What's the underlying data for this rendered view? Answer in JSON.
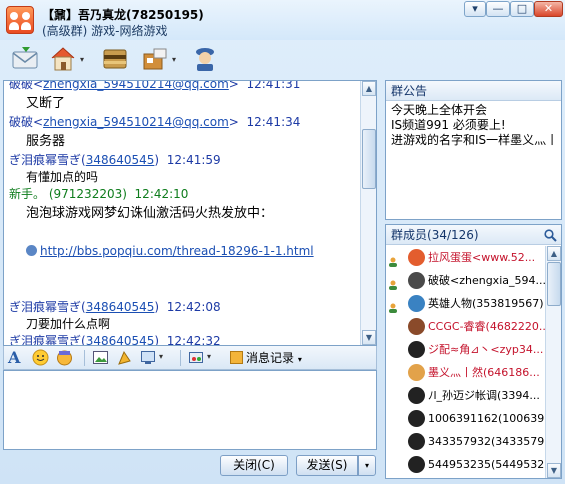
{
  "window": {
    "title": "【鼐】吾乃真龙(78250195)",
    "subtitle": "(高级群) 游戏-网络游戏",
    "buttons": {
      "menu": "▾",
      "minimize": "—",
      "maximize": "□",
      "close": "✕"
    }
  },
  "toolbar": {
    "items": [
      {
        "icon": "email-icon"
      },
      {
        "icon": "home-icon"
      },
      {
        "icon": "share-icon"
      },
      {
        "icon": "apps-icon"
      },
      {
        "icon": "manage-icon"
      }
    ]
  },
  "chat": {
    "messages": [
      {
        "sender": "破破",
        "email": "zhengxia_594510214@qq.com",
        "time": "12:41:31",
        "text": "又断了"
      },
      {
        "sender": "破破",
        "email": "zhengxia_594510214@qq.com",
        "time": "12:41:34",
        "text": "服务器"
      },
      {
        "sender": "ぎ泪痕幂雪ぎ",
        "qq": "348640545",
        "time": "12:41:59",
        "text": "有懂加点的吗"
      },
      {
        "sender": "新手。",
        "qq": "971232203",
        "time": "12:42:10",
        "text": "泡泡球游戏网梦幻诛仙激活码火热发放中：",
        "link": "http://bbs.popqiu.com/thread-18296-1-1.html"
      },
      {
        "sender": "ぎ泪痕幂雪ぎ",
        "qq": "348640545",
        "time": "12:42:08",
        "text": "刀要加什么点啊"
      },
      {
        "sender": "ぎ泪痕幂雪ぎ",
        "qq": "348640545",
        "time": "12:42:32",
        "text": ""
      }
    ]
  },
  "format_bar": {
    "history_label": "消息记录"
  },
  "actions": {
    "close_label": "关闭(C)",
    "send_label": "发送(S)"
  },
  "notice": {
    "title": "群公告",
    "lines": [
      "今天晚上全体开会",
      "IS频道991 必须要上!",
      "进游戏的名字和IS一样墨义灬丨"
    ]
  },
  "members": {
    "title": "群成员",
    "count": "(34/126)",
    "list": [
      {
        "text": "拉风蛋蛋<www.52...",
        "color": "#c4122b",
        "status": "admin",
        "avatar": "#e35d2e"
      },
      {
        "text": "破破<zhengxia_594...",
        "color": "#000000",
        "status": "admin",
        "avatar": "#4a4a4a"
      },
      {
        "text": "英雄人物(353819567)",
        "color": "#000000",
        "status": "admin",
        "avatar": "#3a82c2"
      },
      {
        "text": "CCGC-睿睿(4682220...",
        "color": "#c4122b",
        "status": "",
        "avatar": "#8a4a2a"
      },
      {
        "text": "ジ配≈角⊿丶<zyp34...",
        "color": "#c4122b",
        "status": "",
        "avatar": "#222222"
      },
      {
        "text": "墨义灬丨然(646186...",
        "color": "#c4122b",
        "status": "",
        "avatar": "#e2a24a"
      },
      {
        "text": "ﾉl_孙迈ジ帐调(3394...",
        "color": "#000000",
        "status": "",
        "avatar": "#222222"
      },
      {
        "text": "1006391162(100639...",
        "color": "#000000",
        "status": "",
        "avatar": "#222222"
      },
      {
        "text": "343357932(3433579...",
        "color": "#000000",
        "status": "",
        "avatar": "#222222"
      },
      {
        "text": "544953235(5449532...",
        "color": "#000000",
        "status": "",
        "avatar": "#222222"
      }
    ]
  }
}
